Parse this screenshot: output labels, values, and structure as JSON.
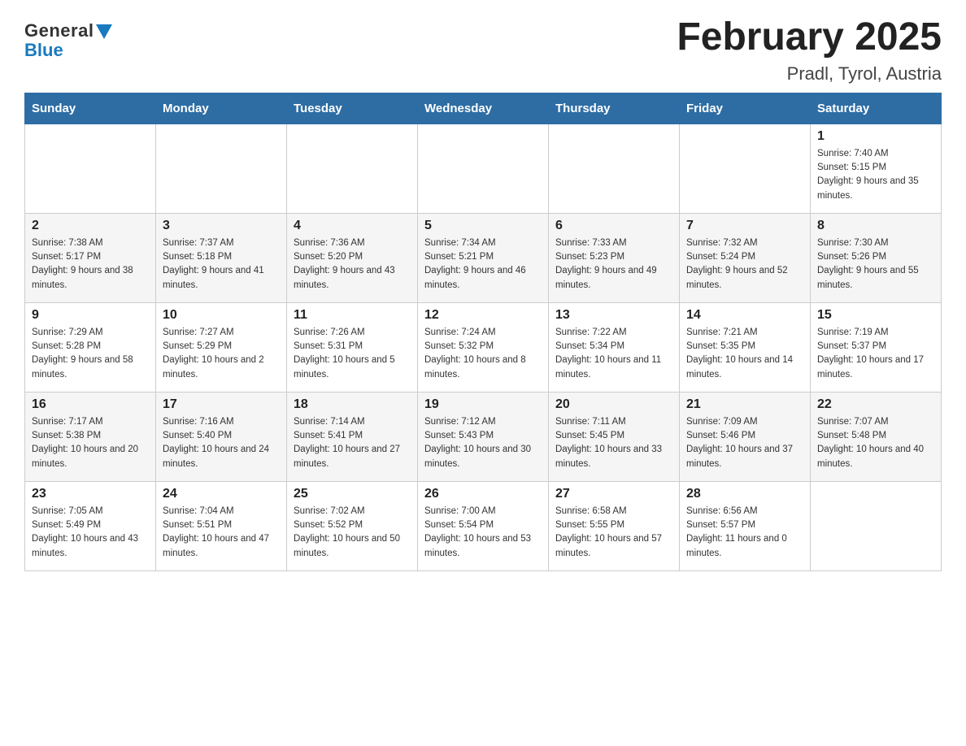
{
  "header": {
    "logo_text_general": "General",
    "logo_text_blue": "Blue",
    "title": "February 2025",
    "subtitle": "Pradl, Tyrol, Austria"
  },
  "weekdays": [
    "Sunday",
    "Monday",
    "Tuesday",
    "Wednesday",
    "Thursday",
    "Friday",
    "Saturday"
  ],
  "weeks": [
    [
      {
        "day": "",
        "sunrise": "",
        "sunset": "",
        "daylight": ""
      },
      {
        "day": "",
        "sunrise": "",
        "sunset": "",
        "daylight": ""
      },
      {
        "day": "",
        "sunrise": "",
        "sunset": "",
        "daylight": ""
      },
      {
        "day": "",
        "sunrise": "",
        "sunset": "",
        "daylight": ""
      },
      {
        "day": "",
        "sunrise": "",
        "sunset": "",
        "daylight": ""
      },
      {
        "day": "",
        "sunrise": "",
        "sunset": "",
        "daylight": ""
      },
      {
        "day": "1",
        "sunrise": "Sunrise: 7:40 AM",
        "sunset": "Sunset: 5:15 PM",
        "daylight": "Daylight: 9 hours and 35 minutes."
      }
    ],
    [
      {
        "day": "2",
        "sunrise": "Sunrise: 7:38 AM",
        "sunset": "Sunset: 5:17 PM",
        "daylight": "Daylight: 9 hours and 38 minutes."
      },
      {
        "day": "3",
        "sunrise": "Sunrise: 7:37 AM",
        "sunset": "Sunset: 5:18 PM",
        "daylight": "Daylight: 9 hours and 41 minutes."
      },
      {
        "day": "4",
        "sunrise": "Sunrise: 7:36 AM",
        "sunset": "Sunset: 5:20 PM",
        "daylight": "Daylight: 9 hours and 43 minutes."
      },
      {
        "day": "5",
        "sunrise": "Sunrise: 7:34 AM",
        "sunset": "Sunset: 5:21 PM",
        "daylight": "Daylight: 9 hours and 46 minutes."
      },
      {
        "day": "6",
        "sunrise": "Sunrise: 7:33 AM",
        "sunset": "Sunset: 5:23 PM",
        "daylight": "Daylight: 9 hours and 49 minutes."
      },
      {
        "day": "7",
        "sunrise": "Sunrise: 7:32 AM",
        "sunset": "Sunset: 5:24 PM",
        "daylight": "Daylight: 9 hours and 52 minutes."
      },
      {
        "day": "8",
        "sunrise": "Sunrise: 7:30 AM",
        "sunset": "Sunset: 5:26 PM",
        "daylight": "Daylight: 9 hours and 55 minutes."
      }
    ],
    [
      {
        "day": "9",
        "sunrise": "Sunrise: 7:29 AM",
        "sunset": "Sunset: 5:28 PM",
        "daylight": "Daylight: 9 hours and 58 minutes."
      },
      {
        "day": "10",
        "sunrise": "Sunrise: 7:27 AM",
        "sunset": "Sunset: 5:29 PM",
        "daylight": "Daylight: 10 hours and 2 minutes."
      },
      {
        "day": "11",
        "sunrise": "Sunrise: 7:26 AM",
        "sunset": "Sunset: 5:31 PM",
        "daylight": "Daylight: 10 hours and 5 minutes."
      },
      {
        "day": "12",
        "sunrise": "Sunrise: 7:24 AM",
        "sunset": "Sunset: 5:32 PM",
        "daylight": "Daylight: 10 hours and 8 minutes."
      },
      {
        "day": "13",
        "sunrise": "Sunrise: 7:22 AM",
        "sunset": "Sunset: 5:34 PM",
        "daylight": "Daylight: 10 hours and 11 minutes."
      },
      {
        "day": "14",
        "sunrise": "Sunrise: 7:21 AM",
        "sunset": "Sunset: 5:35 PM",
        "daylight": "Daylight: 10 hours and 14 minutes."
      },
      {
        "day": "15",
        "sunrise": "Sunrise: 7:19 AM",
        "sunset": "Sunset: 5:37 PM",
        "daylight": "Daylight: 10 hours and 17 minutes."
      }
    ],
    [
      {
        "day": "16",
        "sunrise": "Sunrise: 7:17 AM",
        "sunset": "Sunset: 5:38 PM",
        "daylight": "Daylight: 10 hours and 20 minutes."
      },
      {
        "day": "17",
        "sunrise": "Sunrise: 7:16 AM",
        "sunset": "Sunset: 5:40 PM",
        "daylight": "Daylight: 10 hours and 24 minutes."
      },
      {
        "day": "18",
        "sunrise": "Sunrise: 7:14 AM",
        "sunset": "Sunset: 5:41 PM",
        "daylight": "Daylight: 10 hours and 27 minutes."
      },
      {
        "day": "19",
        "sunrise": "Sunrise: 7:12 AM",
        "sunset": "Sunset: 5:43 PM",
        "daylight": "Daylight: 10 hours and 30 minutes."
      },
      {
        "day": "20",
        "sunrise": "Sunrise: 7:11 AM",
        "sunset": "Sunset: 5:45 PM",
        "daylight": "Daylight: 10 hours and 33 minutes."
      },
      {
        "day": "21",
        "sunrise": "Sunrise: 7:09 AM",
        "sunset": "Sunset: 5:46 PM",
        "daylight": "Daylight: 10 hours and 37 minutes."
      },
      {
        "day": "22",
        "sunrise": "Sunrise: 7:07 AM",
        "sunset": "Sunset: 5:48 PM",
        "daylight": "Daylight: 10 hours and 40 minutes."
      }
    ],
    [
      {
        "day": "23",
        "sunrise": "Sunrise: 7:05 AM",
        "sunset": "Sunset: 5:49 PM",
        "daylight": "Daylight: 10 hours and 43 minutes."
      },
      {
        "day": "24",
        "sunrise": "Sunrise: 7:04 AM",
        "sunset": "Sunset: 5:51 PM",
        "daylight": "Daylight: 10 hours and 47 minutes."
      },
      {
        "day": "25",
        "sunrise": "Sunrise: 7:02 AM",
        "sunset": "Sunset: 5:52 PM",
        "daylight": "Daylight: 10 hours and 50 minutes."
      },
      {
        "day": "26",
        "sunrise": "Sunrise: 7:00 AM",
        "sunset": "Sunset: 5:54 PM",
        "daylight": "Daylight: 10 hours and 53 minutes."
      },
      {
        "day": "27",
        "sunrise": "Sunrise: 6:58 AM",
        "sunset": "Sunset: 5:55 PM",
        "daylight": "Daylight: 10 hours and 57 minutes."
      },
      {
        "day": "28",
        "sunrise": "Sunrise: 6:56 AM",
        "sunset": "Sunset: 5:57 PM",
        "daylight": "Daylight: 11 hours and 0 minutes."
      },
      {
        "day": "",
        "sunrise": "",
        "sunset": "",
        "daylight": ""
      }
    ]
  ]
}
